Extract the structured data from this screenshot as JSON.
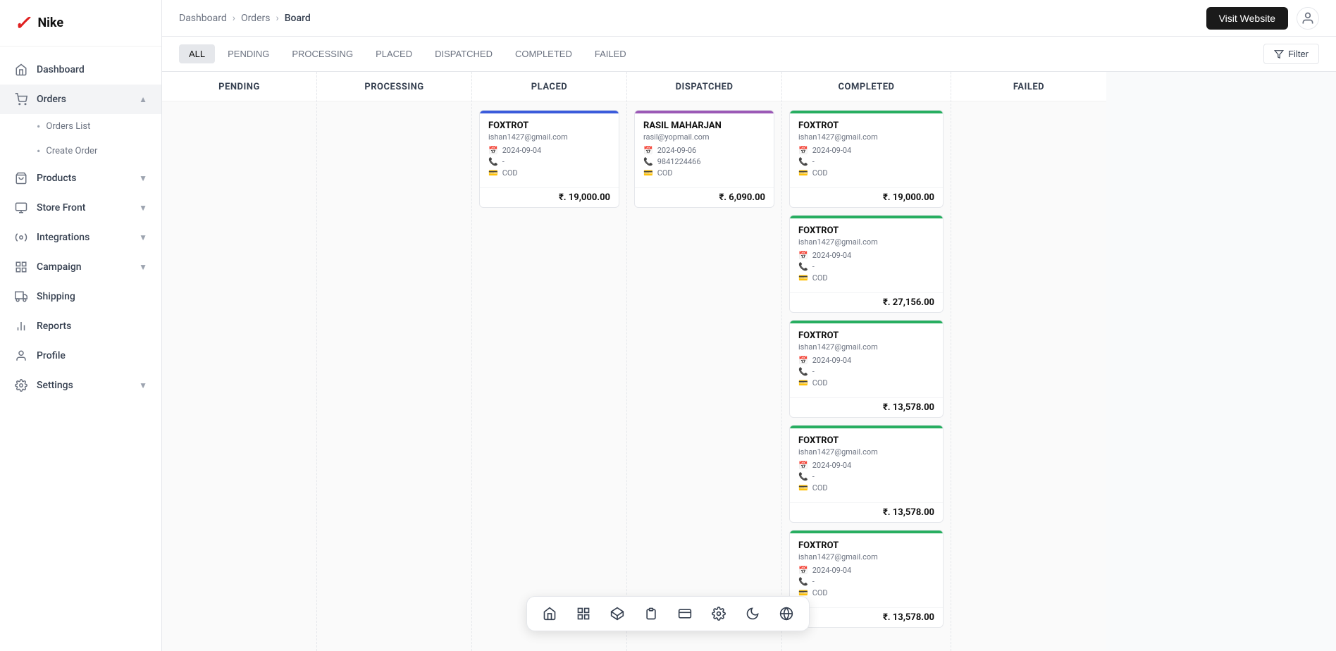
{
  "brand": {
    "logo": "✔",
    "name": "Nike"
  },
  "sidebar": {
    "items": [
      {
        "id": "dashboard",
        "label": "Dashboard",
        "icon": "🏠",
        "hasChevron": false
      },
      {
        "id": "orders",
        "label": "Orders",
        "icon": "🛒",
        "hasChevron": true,
        "expanded": true
      },
      {
        "id": "products",
        "label": "Products",
        "icon": "🛍️",
        "hasChevron": true
      },
      {
        "id": "storefront",
        "label": "Store Front",
        "icon": "🖥️",
        "hasChevron": true
      },
      {
        "id": "integrations",
        "label": "Integrations",
        "icon": "🔌",
        "hasChevron": true
      },
      {
        "id": "campaign",
        "label": "Campaign",
        "icon": "📦",
        "hasChevron": true
      },
      {
        "id": "shipping",
        "label": "Shipping",
        "icon": "🚚",
        "hasChevron": false
      },
      {
        "id": "reports",
        "label": "Reports",
        "icon": "📊",
        "hasChevron": false
      },
      {
        "id": "profile",
        "label": "Profile",
        "icon": "👤",
        "hasChevron": false
      },
      {
        "id": "settings",
        "label": "Settings",
        "icon": "⚙️",
        "hasChevron": true
      }
    ],
    "orders_subitems": [
      {
        "label": "Orders List"
      },
      {
        "label": "Create Order"
      }
    ]
  },
  "topbar": {
    "breadcrumb": [
      "Dashboard",
      "Orders",
      "Board"
    ],
    "visit_website_label": "Visit Website"
  },
  "filter_tabs": [
    {
      "id": "all",
      "label": "ALL",
      "active": true
    },
    {
      "id": "pending",
      "label": "PENDING"
    },
    {
      "id": "processing",
      "label": "PROCESSING"
    },
    {
      "id": "placed",
      "label": "PLACED"
    },
    {
      "id": "dispatched",
      "label": "DISPATCHED"
    },
    {
      "id": "completed",
      "label": "COMPLETED"
    },
    {
      "id": "failed",
      "label": "FAILED"
    }
  ],
  "filter_button_label": "Filter",
  "board": {
    "columns": [
      {
        "id": "pending",
        "label": "PENDING",
        "cards": []
      },
      {
        "id": "processing",
        "label": "PROCESSING",
        "cards": []
      },
      {
        "id": "placed",
        "label": "PLACED",
        "border_color": "#3b5bdb",
        "cards": [
          {
            "name": "FOXTROT",
            "email": "ishan1427@gmail.com",
            "date": "2024-09-04",
            "phone": "-",
            "payment": "COD",
            "amount": "₹. 19,000.00",
            "border_color": "#3b5bdb"
          }
        ]
      },
      {
        "id": "dispatched",
        "label": "DISPATCHED",
        "border_color": "#9b59b6",
        "cards": [
          {
            "name": "RASIL MAHARJAN",
            "email": "rasil@yopmail.com",
            "date": "2024-09-06",
            "phone": "9841224466",
            "payment": "COD",
            "amount": "₹. 6,090.00",
            "border_color": "#9b59b6"
          }
        ]
      },
      {
        "id": "completed",
        "label": "COMPLETED",
        "border_color": "#27ae60",
        "cards": [
          {
            "name": "FOXTROT",
            "email": "ishan1427@gmail.com",
            "date": "2024-09-04",
            "phone": "-",
            "payment": "COD",
            "amount": "₹. 19,000.00",
            "border_color": "#27ae60"
          },
          {
            "name": "FOXTROT",
            "email": "ishan1427@gmail.com",
            "date": "2024-09-04",
            "phone": "-",
            "payment": "COD",
            "amount": "₹. 27,156.00",
            "border_color": "#27ae60"
          },
          {
            "name": "FOXTROT",
            "email": "ishan1427@gmail.com",
            "date": "2024-09-04",
            "phone": "-",
            "payment": "COD",
            "amount": "₹. 13,578.00",
            "border_color": "#27ae60"
          },
          {
            "name": "FOXTROT",
            "email": "ishan1427@gmail.com",
            "date": "2024-09-04",
            "phone": "-",
            "payment": "COD",
            "amount": "₹. 13,578.00",
            "border_color": "#27ae60"
          },
          {
            "name": "FOXTROT",
            "email": "ishan1427@gmail.com",
            "date": "2024-09-04",
            "phone": "-",
            "payment": "COD",
            "amount": "₹. 13,578.00",
            "border_color": "#27ae60"
          }
        ]
      },
      {
        "id": "failed",
        "label": "FAILED",
        "cards": []
      }
    ]
  },
  "floating_toolbar": {
    "icons": [
      {
        "id": "home",
        "symbol": "🏠",
        "label": "home-icon"
      },
      {
        "id": "grid",
        "symbol": "⊞",
        "label": "grid-icon"
      },
      {
        "id": "cube",
        "symbol": "◈",
        "label": "cube-icon"
      },
      {
        "id": "clipboard",
        "symbol": "📋",
        "label": "clipboard-icon"
      },
      {
        "id": "card",
        "symbol": "🗂️",
        "label": "card-icon"
      },
      {
        "id": "gear",
        "symbol": "⚙️",
        "label": "gear-icon"
      },
      {
        "id": "moon",
        "symbol": "🌙",
        "label": "moon-icon"
      },
      {
        "id": "globe",
        "symbol": "🌐",
        "label": "globe-icon"
      }
    ]
  }
}
